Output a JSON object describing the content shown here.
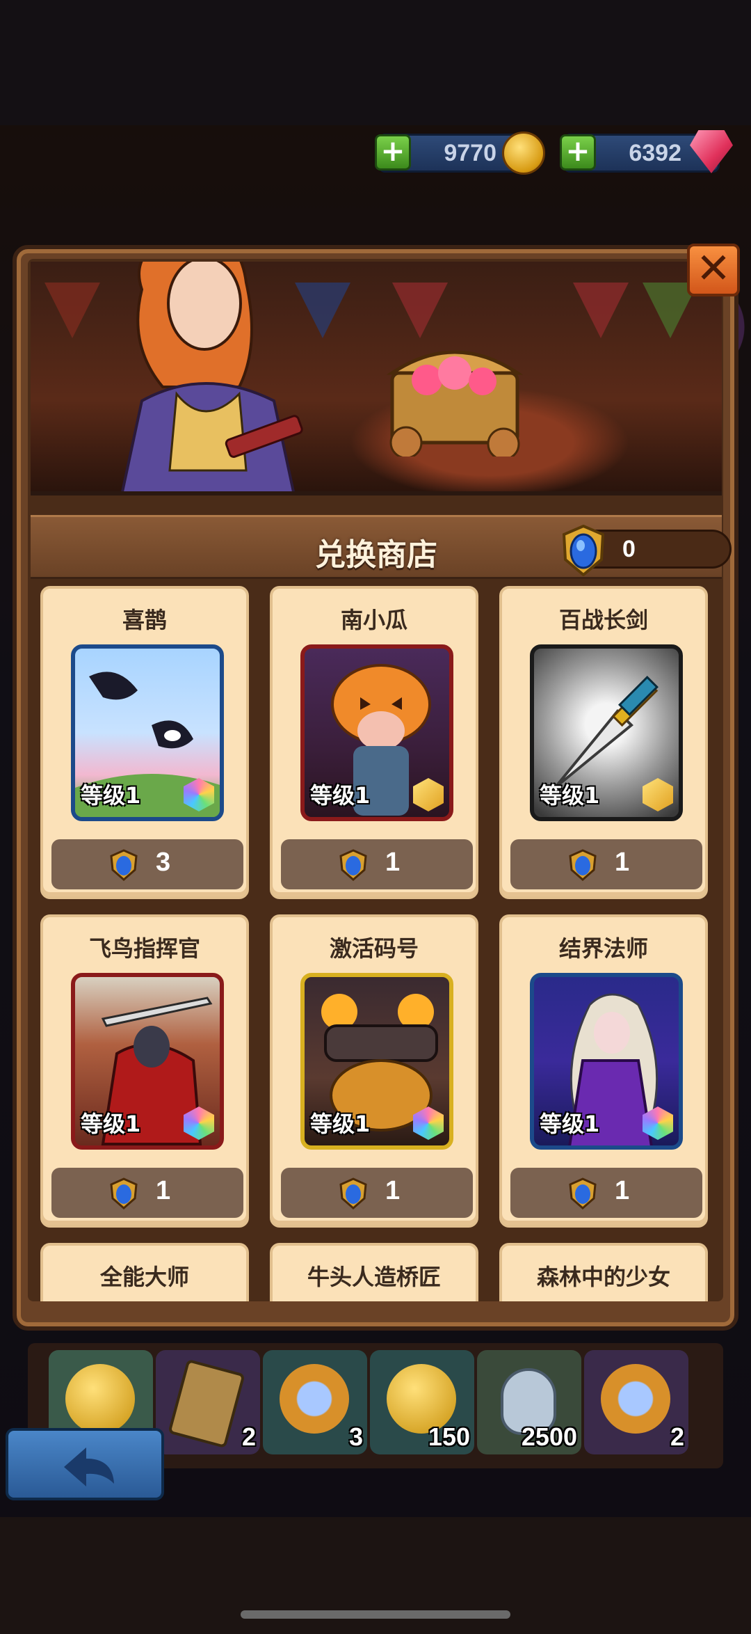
{
  "currency": {
    "gold": "9770",
    "gems": "6392"
  },
  "shop": {
    "title": "兑换商店",
    "token_balance": "0"
  },
  "items": [
    {
      "name": "喜鹊",
      "level": "等级1",
      "cost": "3",
      "rarity": "rainbow",
      "art": "magpie"
    },
    {
      "name": "南小瓜",
      "level": "等级1",
      "cost": "1",
      "rarity": "gold",
      "art": "pumpkin"
    },
    {
      "name": "百战长剑",
      "level": "等级1",
      "cost": "1",
      "rarity": "gold",
      "art": "sword"
    },
    {
      "name": "飞鸟指挥官",
      "level": "等级1",
      "cost": "1",
      "rarity": "rainbow",
      "art": "bird"
    },
    {
      "name": "激活码号",
      "level": "等级1",
      "cost": "1",
      "rarity": "rainbow",
      "art": "cat"
    },
    {
      "name": "结界法师",
      "level": "等级1",
      "cost": "1",
      "rarity": "rainbow",
      "art": "mage"
    },
    {
      "name": "全能大师"
    },
    {
      "name": "牛头人造桥匠"
    },
    {
      "name": "森林中的少女"
    }
  ],
  "tray": [
    {
      "icon": "gold-coin-icon",
      "count": ""
    },
    {
      "icon": "card-pack-icon",
      "count": "2"
    },
    {
      "icon": "crystal-coin-icon",
      "count": "3"
    },
    {
      "icon": "gold-coin-icon",
      "count": "150"
    },
    {
      "icon": "potion-icon",
      "count": "2500"
    },
    {
      "icon": "crystal-coin-icon",
      "count": "2"
    }
  ],
  "colors": {
    "panel_wood": "#6a4226",
    "card_bg": "#fbe1b8",
    "price_bg": "#7b6250",
    "close_orange": "#f08a3a",
    "back_blue": "#3a74b4"
  }
}
